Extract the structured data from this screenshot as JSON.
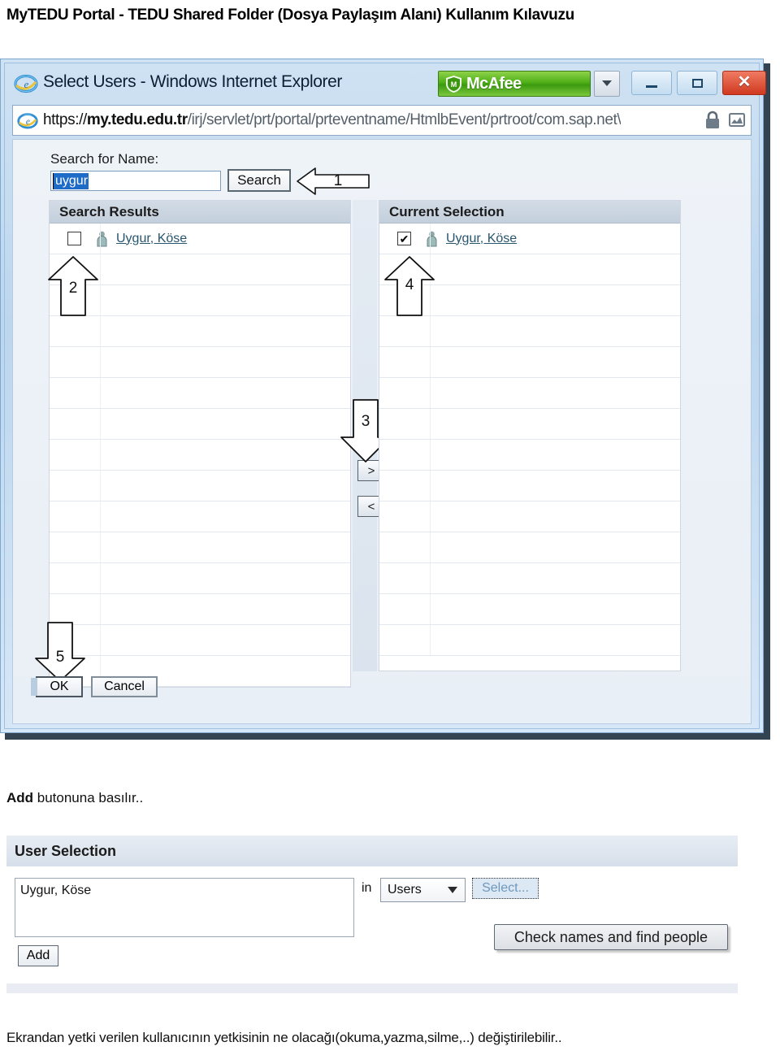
{
  "document": {
    "header_title": "MyTEDU Portal - TEDU Shared Folder (Dosya Paylaşım Alanı) Kullanım Kılavuzu",
    "caption_between_bold": "Add",
    "caption_between_rest": " butonuna basılır..",
    "caption_bottom": "Ekrandan yetki verilen kullanıcının yetkisinin ne olacağı(okuma,yazma,silme,..) değiştirilebilir.."
  },
  "browser_window": {
    "title": "Select Users - Windows Internet Explorer",
    "ie_icon": "internet-explorer-icon",
    "address_scheme": "https://",
    "address_domain": "my.tedu.edu.tr",
    "address_path": "/irj/servlet/prt/portal/prteventname/HtmlbEvent/prtroot/com.sap.net\\",
    "lock_icon": "lock-icon",
    "compat_icon": "compatibility-view-icon",
    "mcafee_label": "McAfee",
    "mcafee_shield_icon": "mcafee-shield-icon",
    "mcafee_dropdown_icon": "chevron-down-icon",
    "minimize_label": "minimize-icon",
    "maximize_label": "maximize-icon",
    "close_label": "✕",
    "accent_green": "#4faf17",
    "accent_close_red": "#cf3a20",
    "chrome_blue": "#cfe2f3"
  },
  "select_users_dialog": {
    "search_label": "Search for Name:",
    "search_value": "uygur",
    "search_placeholder": "",
    "search_button": "Search",
    "results_header": "Search Results",
    "selection_header": "Current Selection",
    "results_rows": [
      {
        "checked": false,
        "name": "Uygur, Köse"
      }
    ],
    "selection_rows": [
      {
        "checked": true,
        "name": "Uygur, Köse"
      }
    ],
    "transfer_forward": ">",
    "transfer_back": "<",
    "ok_button": "OK",
    "cancel_button": "Cancel",
    "user_icon": "user-icon",
    "annotations": [
      {
        "number": "1",
        "direction": "left",
        "target": "search-button"
      },
      {
        "number": "2",
        "direction": "up",
        "target": "result-row-checkbox"
      },
      {
        "number": "3",
        "direction": "down",
        "target": "transfer-forward-button"
      },
      {
        "number": "4",
        "direction": "up",
        "target": "selection-row-checkbox"
      },
      {
        "number": "5",
        "direction": "down",
        "target": "ok-button"
      }
    ]
  },
  "user_selection_panel": {
    "header": "User Selection",
    "names_value": "Uygur, Köse",
    "in_label": "in",
    "scope_value": "Users",
    "scope_caret": "chevron-down-icon",
    "select_link": "Select...",
    "tooltip": "Check names and find people",
    "add_button": "Add"
  }
}
